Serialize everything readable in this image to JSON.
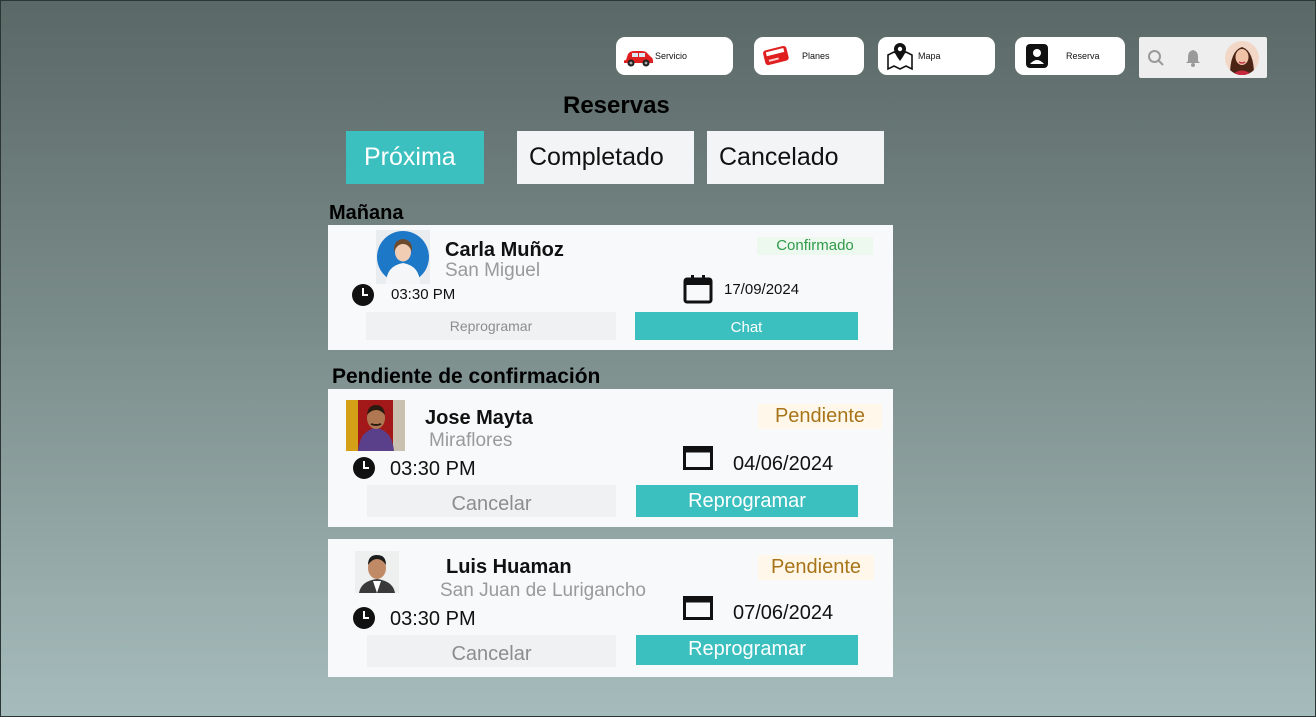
{
  "nav": {
    "servicio": "Servicio",
    "planes": "Planes",
    "mapa": "Mapa",
    "reserva": "Reserva"
  },
  "page_title": "Reservas",
  "tabs": {
    "proxima": "Próxima",
    "completado": "Completado",
    "cancelado": "Cancelado"
  },
  "sections": {
    "manana": "Mañana",
    "pendiente": "Pendiente de confirmación"
  },
  "cards": [
    {
      "name": "Carla Muñoz",
      "place": "San Miguel",
      "status": "Confirmado",
      "time": "03:30 PM",
      "date": "17/09/2024",
      "secondary": "Reprogramar",
      "primary": "Chat"
    },
    {
      "name": "Jose Mayta",
      "place": "Miraflores",
      "status": "Pendiente",
      "time": "03:30 PM",
      "date": "04/06/2024",
      "secondary": "Cancelar",
      "primary": "Reprogramar"
    },
    {
      "name": "Luis Huaman",
      "place": "San Juan de Lurigancho",
      "status": "Pendiente",
      "time": "03:30 PM",
      "date": "07/06/2024",
      "secondary": "Cancelar",
      "primary": "Reprogramar"
    }
  ],
  "colors": {
    "accent": "#3cbfbf",
    "confirmed": "#2e9a4a",
    "pending": "#a7741a"
  },
  "icons": [
    "car-icon",
    "ticket-icon",
    "map-pin-icon",
    "user-card-icon",
    "search-icon",
    "bell-icon",
    "clock-icon",
    "calendar-icon"
  ]
}
